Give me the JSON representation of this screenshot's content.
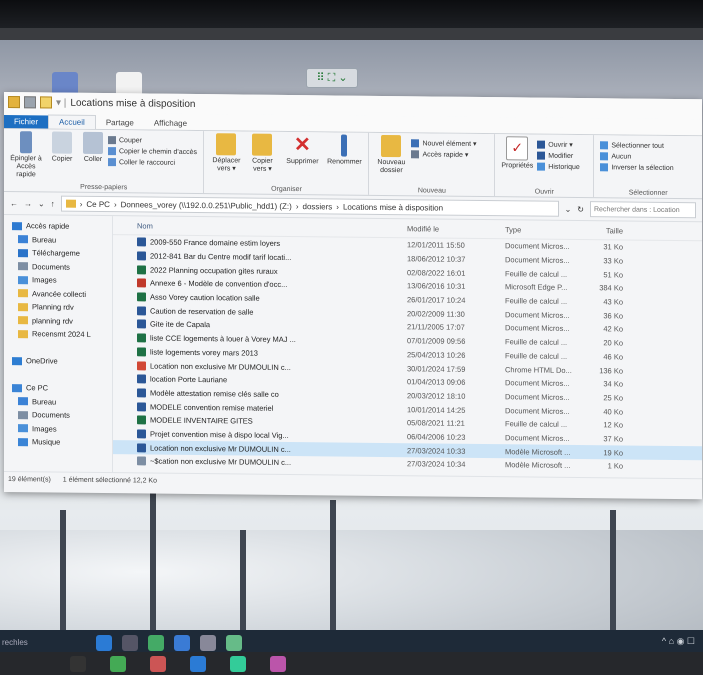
{
  "window": {
    "title": "Locations mise à disposition"
  },
  "snap_label": "⠿ ⛶ ⌄",
  "tabs": [
    "Fichier",
    "Accueil",
    "Partage",
    "Affichage"
  ],
  "ribbon": {
    "presse_papiers": {
      "title": "Presse-papiers",
      "pin": "Épingler à Accès rapide",
      "copy": "Copier",
      "paste": "Coller",
      "cut": "Couper",
      "copy_path": "Copier le chemin d'accès",
      "paste_shortcut": "Coller le raccourci"
    },
    "organiser": {
      "title": "Organiser",
      "move": "Déplacer vers ▾",
      "copy_to": "Copier vers ▾",
      "delete": "Supprimer",
      "rename": "Renommer"
    },
    "nouveau": {
      "title": "Nouveau",
      "new_folder": "Nouveau dossier",
      "new_item": "Nouvel élément ▾",
      "easy_access": "Accès rapide ▾"
    },
    "ouvrir": {
      "title": "Ouvrir",
      "properties": "Propriétés",
      "open": "Ouvrir ▾",
      "edit": "Modifier",
      "history": "Historique"
    },
    "selectionner": {
      "title": "Sélectionner",
      "select_all": "Sélectionner tout",
      "none": "Aucun",
      "invert": "Inverser la sélection"
    }
  },
  "address": {
    "path": [
      "Ce PC",
      "Donnees_vorey (\\\\192.0.0.251\\Public_hdd1) (Z:)",
      "dossiers",
      "Locations mise à disposition"
    ],
    "search_placeholder": "Rechercher dans : Location"
  },
  "nav": [
    {
      "label": "Accès rapide",
      "level": 1,
      "icon": "star",
      "color": "#2e7ad1"
    },
    {
      "label": "Bureau",
      "level": 2,
      "icon": "desktop",
      "color": "#3b82d6"
    },
    {
      "label": "Téléchargeme",
      "level": 2,
      "icon": "download",
      "color": "#2a73c9"
    },
    {
      "label": "Documents",
      "level": 2,
      "icon": "docs",
      "color": "#7d8ea3"
    },
    {
      "label": "Images",
      "level": 2,
      "icon": "images",
      "color": "#4a90d9"
    },
    {
      "label": "Avancée collecti",
      "level": 2,
      "icon": "folder",
      "color": "#e8b842"
    },
    {
      "label": "Planning rdv",
      "level": 2,
      "icon": "folder",
      "color": "#e8b842"
    },
    {
      "label": "planning rdv",
      "level": 2,
      "icon": "folder",
      "color": "#e8b842"
    },
    {
      "label": "Recensmt 2024 L",
      "level": 2,
      "icon": "folder",
      "color": "#e8b842"
    },
    {
      "label": "",
      "level": 2,
      "icon": "",
      "color": "transparent"
    },
    {
      "label": "OneDrive",
      "level": 1,
      "icon": "cloud",
      "color": "#2d7dd2"
    },
    {
      "label": "",
      "level": 2,
      "icon": "",
      "color": "transparent"
    },
    {
      "label": "Ce PC",
      "level": 1,
      "icon": "pc",
      "color": "#3a84d6"
    },
    {
      "label": "Bureau",
      "level": 2,
      "icon": "desktop",
      "color": "#3b82d6"
    },
    {
      "label": "Documents",
      "level": 2,
      "icon": "docs",
      "color": "#7d8ea3"
    },
    {
      "label": "Images",
      "level": 2,
      "icon": "images",
      "color": "#4a90d9"
    },
    {
      "label": "Musique",
      "level": 2,
      "icon": "music",
      "color": "#3a84d6"
    }
  ],
  "columns": {
    "name": "Nom",
    "date": "Modifié le",
    "type": "Type",
    "size": "Taille"
  },
  "files": [
    {
      "name": "2009-550 France domaine estim loyers",
      "date": "12/01/2011 15:50",
      "type": "Document Micros...",
      "size": "31 Ko",
      "color": "#2b5797"
    },
    {
      "name": "2012-841 Bar du Centre modif tarif locati...",
      "date": "18/06/2012 10:37",
      "type": "Document Micros...",
      "size": "33 Ko",
      "color": "#2b5797"
    },
    {
      "name": "2022 Planning occupation gites ruraux",
      "date": "02/08/2022 16:01",
      "type": "Feuille de calcul ...",
      "size": "51 Ko",
      "color": "#1e7145"
    },
    {
      "name": "Annexe 6 - Modèle de convention d'occ...",
      "date": "13/06/2016 10:31",
      "type": "Microsoft Edge P...",
      "size": "384 Ko",
      "color": "#c0392b"
    },
    {
      "name": "Asso Vorey caution location salle",
      "date": "26/01/2017 10:24",
      "type": "Feuille de calcul ...",
      "size": "43 Ko",
      "color": "#1e7145"
    },
    {
      "name": "Caution de reservation de salle",
      "date": "20/02/2009 11:30",
      "type": "Document Micros...",
      "size": "36 Ko",
      "color": "#2b5797"
    },
    {
      "name": "Gite ite de Capala",
      "date": "21/11/2005 17:07",
      "type": "Document Micros...",
      "size": "42 Ko",
      "color": "#2b5797"
    },
    {
      "name": "liste CCE logements à louer à Vorey MAJ ...",
      "date": "07/01/2009 09:56",
      "type": "Feuille de calcul ...",
      "size": "20 Ko",
      "color": "#1e7145"
    },
    {
      "name": "liste logements vorey mars 2013",
      "date": "25/04/2013 10:26",
      "type": "Feuille de calcul ...",
      "size": "46 Ko",
      "color": "#1e7145"
    },
    {
      "name": "Location non exclusive Mr DUMOULIN c...",
      "date": "30/01/2024 17:59",
      "type": "Chrome HTML Do...",
      "size": "136 Ko",
      "color": "#d14836"
    },
    {
      "name": "location Porte Lauriane",
      "date": "01/04/2013 09:06",
      "type": "Document Micros...",
      "size": "34 Ko",
      "color": "#2b5797"
    },
    {
      "name": "Modèle attestation remise clés salle co",
      "date": "20/03/2012 18:10",
      "type": "Document Micros...",
      "size": "25 Ko",
      "color": "#2b5797"
    },
    {
      "name": "MODELE convention remise materiel",
      "date": "10/01/2014 14:25",
      "type": "Document Micros...",
      "size": "40 Ko",
      "color": "#2b5797"
    },
    {
      "name": "MODELE INVENTAIRE GITES",
      "date": "05/08/2021 11:21",
      "type": "Feuille de calcul ...",
      "size": "12 Ko",
      "color": "#1e7145"
    },
    {
      "name": "Projet convention mise à dispo local Vig...",
      "date": "06/04/2006 10:23",
      "type": "Document Micros...",
      "size": "37 Ko",
      "color": "#2b5797"
    },
    {
      "name": "Location non exclusive Mr DUMOULIN c...",
      "date": "27/03/2024 10:33",
      "type": "Modèle Microsoft ...",
      "size": "19 Ko",
      "color": "#2b5797",
      "selected": true
    },
    {
      "name": "~$cation non exclusive Mr DUMOULIN c...",
      "date": "27/03/2024 10:34",
      "type": "Modèle Microsoft ...",
      "size": "1 Ko",
      "color": "#7d8ea3"
    }
  ],
  "status": {
    "count": "19 élément(s)",
    "selected": "1 élément sélectionné  12,2 Ko"
  },
  "taskbar": {
    "left_text": "rechles",
    "tray": "^ ⌂ ◉ ☐"
  }
}
